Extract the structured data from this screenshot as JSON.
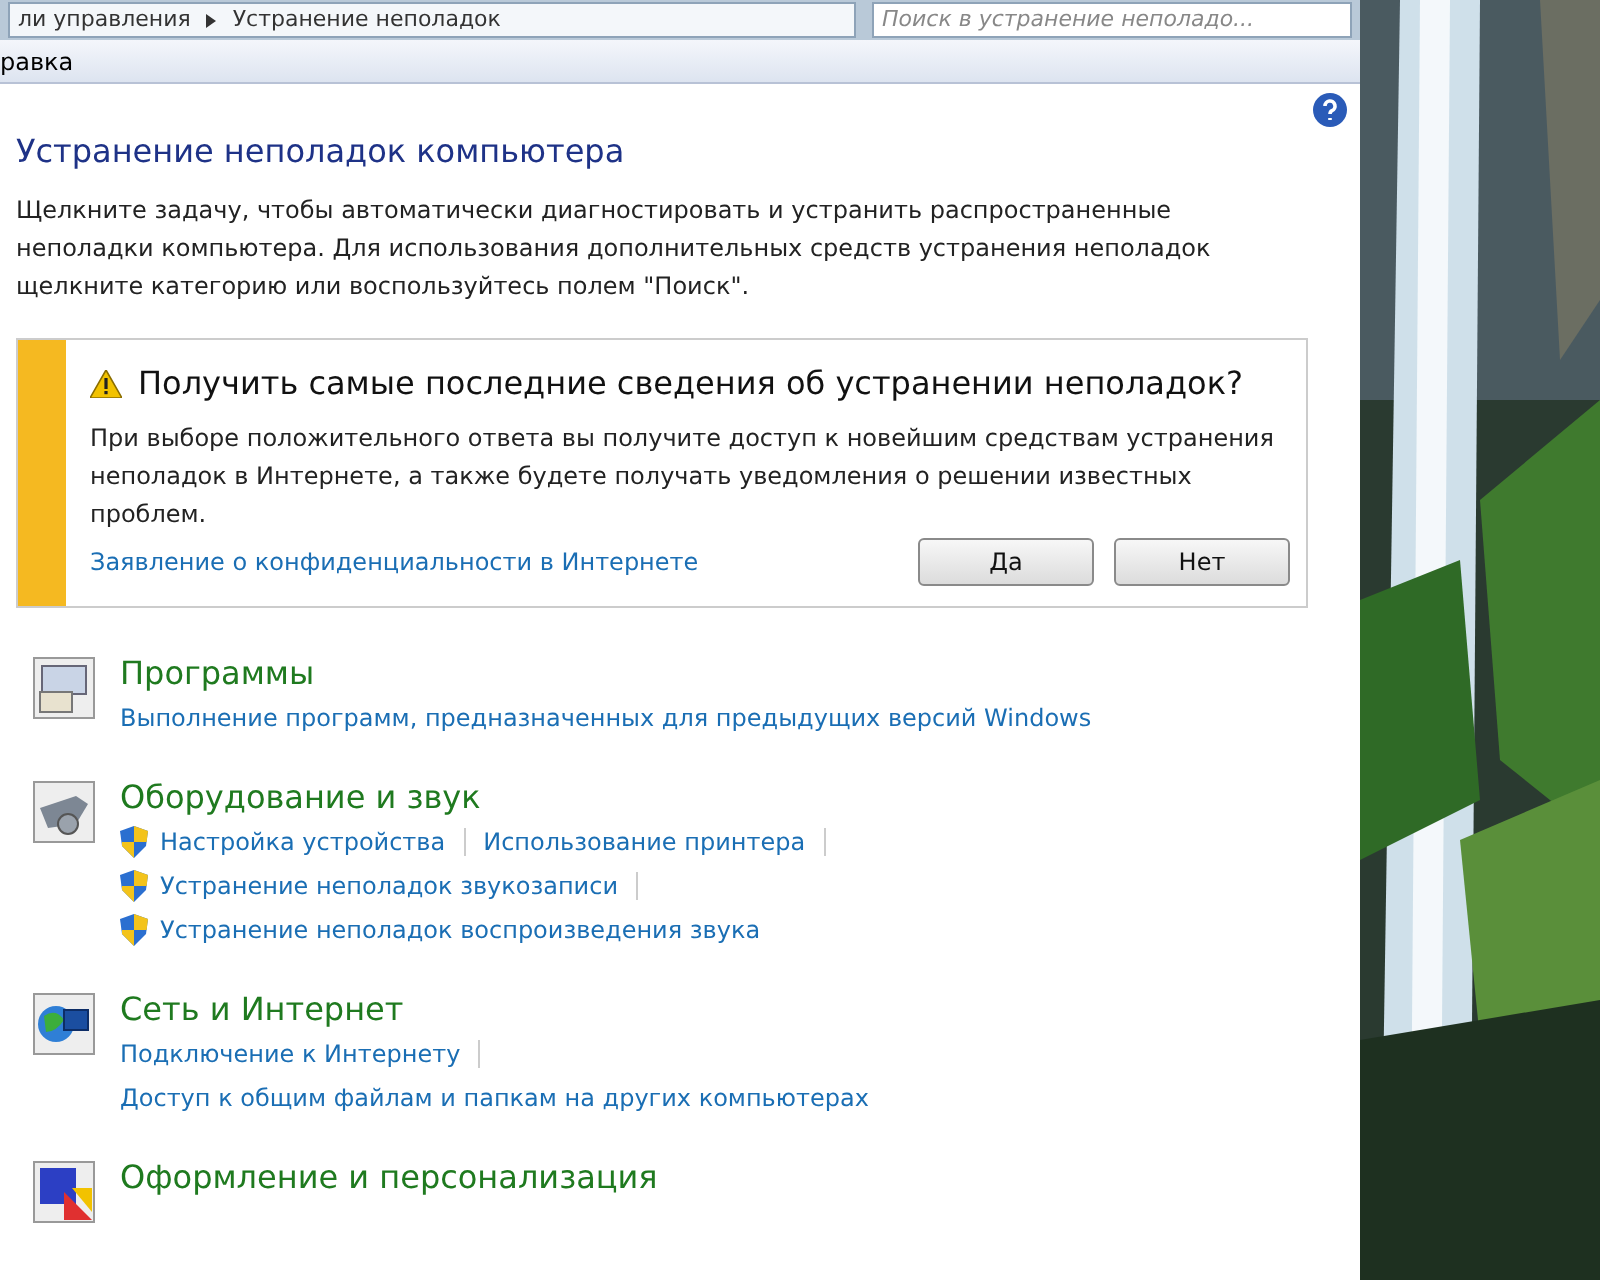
{
  "address_bar": {
    "crumbs": [
      "ли управления",
      "Устранение неполадок"
    ],
    "search_placeholder": "Поиск в устранение неполадо..."
  },
  "menu_bar": {
    "items": [
      "равка"
    ]
  },
  "header": {
    "title": "Устранение неполадок компьютера",
    "description": "Щелкните задачу, чтобы автоматически диагностировать и устранить распространенные неполадки компьютера. Для использования дополнительных средств устранения неполадок щелкните категорию или воспользуйтесь полем \"Поиск\"."
  },
  "notice": {
    "title": "Получить самые последние сведения об устранении неполадок?",
    "text": "При выборе положительного ответа вы получите доступ к новейшим средствам устранения неполадок в Интернете, а также будете получать уведомления о решении известных проблем.",
    "link": "Заявление о конфиденциальности в Интернете",
    "buttons": [
      "Да",
      "Нет"
    ]
  },
  "categories": [
    {
      "title": "Программы",
      "kind": "programs",
      "lines": [
        [
          {
            "text": "Выполнение программ, предназначенных для предыдущих версий Windows",
            "shield": false,
            "separator": false
          }
        ]
      ]
    },
    {
      "title": "Оборудование и звук",
      "kind": "hardware",
      "lines": [
        [
          {
            "text": "Настройка устройства",
            "shield": true,
            "separator": true
          },
          {
            "text": "Использование принтера",
            "shield": false,
            "separator": true
          }
        ],
        [
          {
            "text": "Устранение неполадок звукозаписи",
            "shield": true,
            "separator": true
          }
        ],
        [
          {
            "text": "Устранение неполадок воспроизведения звука",
            "shield": true,
            "separator": false
          }
        ]
      ]
    },
    {
      "title": "Сеть и Интернет",
      "kind": "network",
      "lines": [
        [
          {
            "text": "Подключение к Интернету",
            "shield": false,
            "separator": true
          }
        ],
        [
          {
            "text": "Доступ к общим файлам и папкам на других компьютерах",
            "shield": false,
            "separator": false
          }
        ]
      ]
    },
    {
      "title": "Оформление и персонализация",
      "kind": "appearance"
    }
  ]
}
